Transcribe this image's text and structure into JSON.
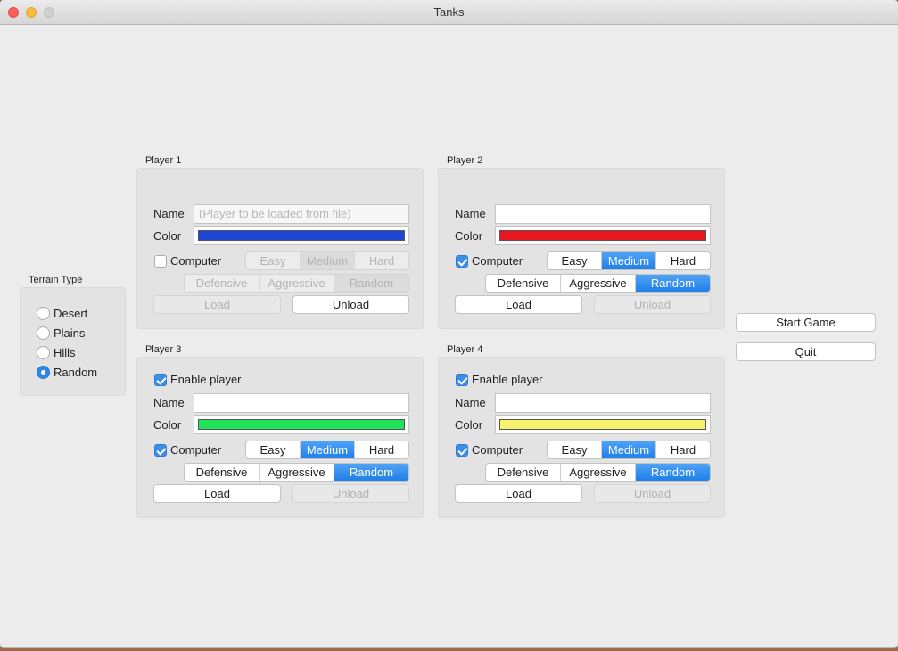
{
  "window": {
    "title": "Tanks"
  },
  "terrain": {
    "title": "Terrain Type",
    "options": [
      "Desert",
      "Plains",
      "Hills",
      "Random"
    ],
    "selected": "Random"
  },
  "labels": {
    "name": "Name",
    "color": "Color"
  },
  "players": [
    {
      "title": "Player 1",
      "name_value": "",
      "name_placeholder": "(Player to be loaded from file)",
      "color": "#1f45d6",
      "computer_label": "Computer",
      "computer_checked": false,
      "difficulty": [
        "Easy",
        "Medium",
        "Hard"
      ],
      "difficulty_selected": "Medium",
      "style": [
        "Defensive",
        "Aggressive",
        "Random"
      ],
      "style_selected": "Random",
      "load_label": "Load",
      "unload_label": "Unload"
    },
    {
      "title": "Player 2",
      "name_value": "",
      "color": "#e8161e",
      "computer_label": "Computer",
      "computer_checked": true,
      "difficulty": [
        "Easy",
        "Medium",
        "Hard"
      ],
      "difficulty_selected": "Medium",
      "style": [
        "Defensive",
        "Aggressive",
        "Random"
      ],
      "style_selected": "Random",
      "load_label": "Load",
      "unload_label": "Unload"
    },
    {
      "title": "Player 3",
      "enable_label": "Enable player",
      "enable_checked": true,
      "name_value": "",
      "color": "#22e25a",
      "computer_label": "Computer",
      "computer_checked": true,
      "difficulty": [
        "Easy",
        "Medium",
        "Hard"
      ],
      "difficulty_selected": "Medium",
      "style": [
        "Defensive",
        "Aggressive",
        "Random"
      ],
      "style_selected": "Random",
      "load_label": "Load",
      "unload_label": "Unload"
    },
    {
      "title": "Player 4",
      "enable_label": "Enable player",
      "enable_checked": true,
      "name_value": "",
      "color": "#f9f36b",
      "computer_label": "Computer",
      "computer_checked": true,
      "difficulty": [
        "Easy",
        "Medium",
        "Hard"
      ],
      "difficulty_selected": "Medium",
      "style": [
        "Defensive",
        "Aggressive",
        "Random"
      ],
      "style_selected": "Random",
      "load_label": "Load",
      "unload_label": "Unload"
    }
  ],
  "actions": {
    "start": "Start Game",
    "quit": "Quit"
  }
}
